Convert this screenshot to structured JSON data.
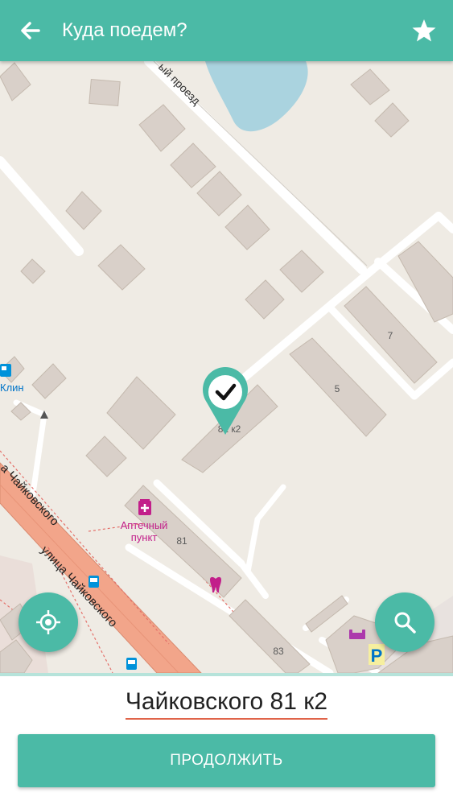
{
  "header": {
    "title": "Куда поедем?",
    "back_icon": "arrow-left-icon",
    "favorite_icon": "star-icon"
  },
  "map": {
    "street_labels": {
      "proezd": "ый проезд",
      "chaikovskogo_upper": "а Чайковского",
      "chaikovskogo_lower": "улица Чайковского"
    },
    "poi": {
      "pharmacy_line1": "Аптечный",
      "pharmacy_line2": "пункт",
      "fuel_label": "Клин",
      "parking": "P"
    },
    "house_numbers": {
      "h7": "7",
      "h5": "5",
      "h81k2": "81 к2",
      "h81": "81",
      "h83": "83"
    },
    "marker_icon": "check-marker-icon"
  },
  "controls": {
    "locate_icon": "crosshair-icon",
    "search_icon": "search-icon"
  },
  "bottom": {
    "address": "Чайковского 81 к2",
    "continue_label": "ПРОДОЛЖИТЬ"
  },
  "colors": {
    "accent": "#4bbaa6",
    "map_bg": "#efebe4",
    "building": "#d9d0c9",
    "water": "#aad3df",
    "main_road": "#f2a58a",
    "underline": "#e0644a",
    "poi_magenta": "#c21f8a"
  }
}
